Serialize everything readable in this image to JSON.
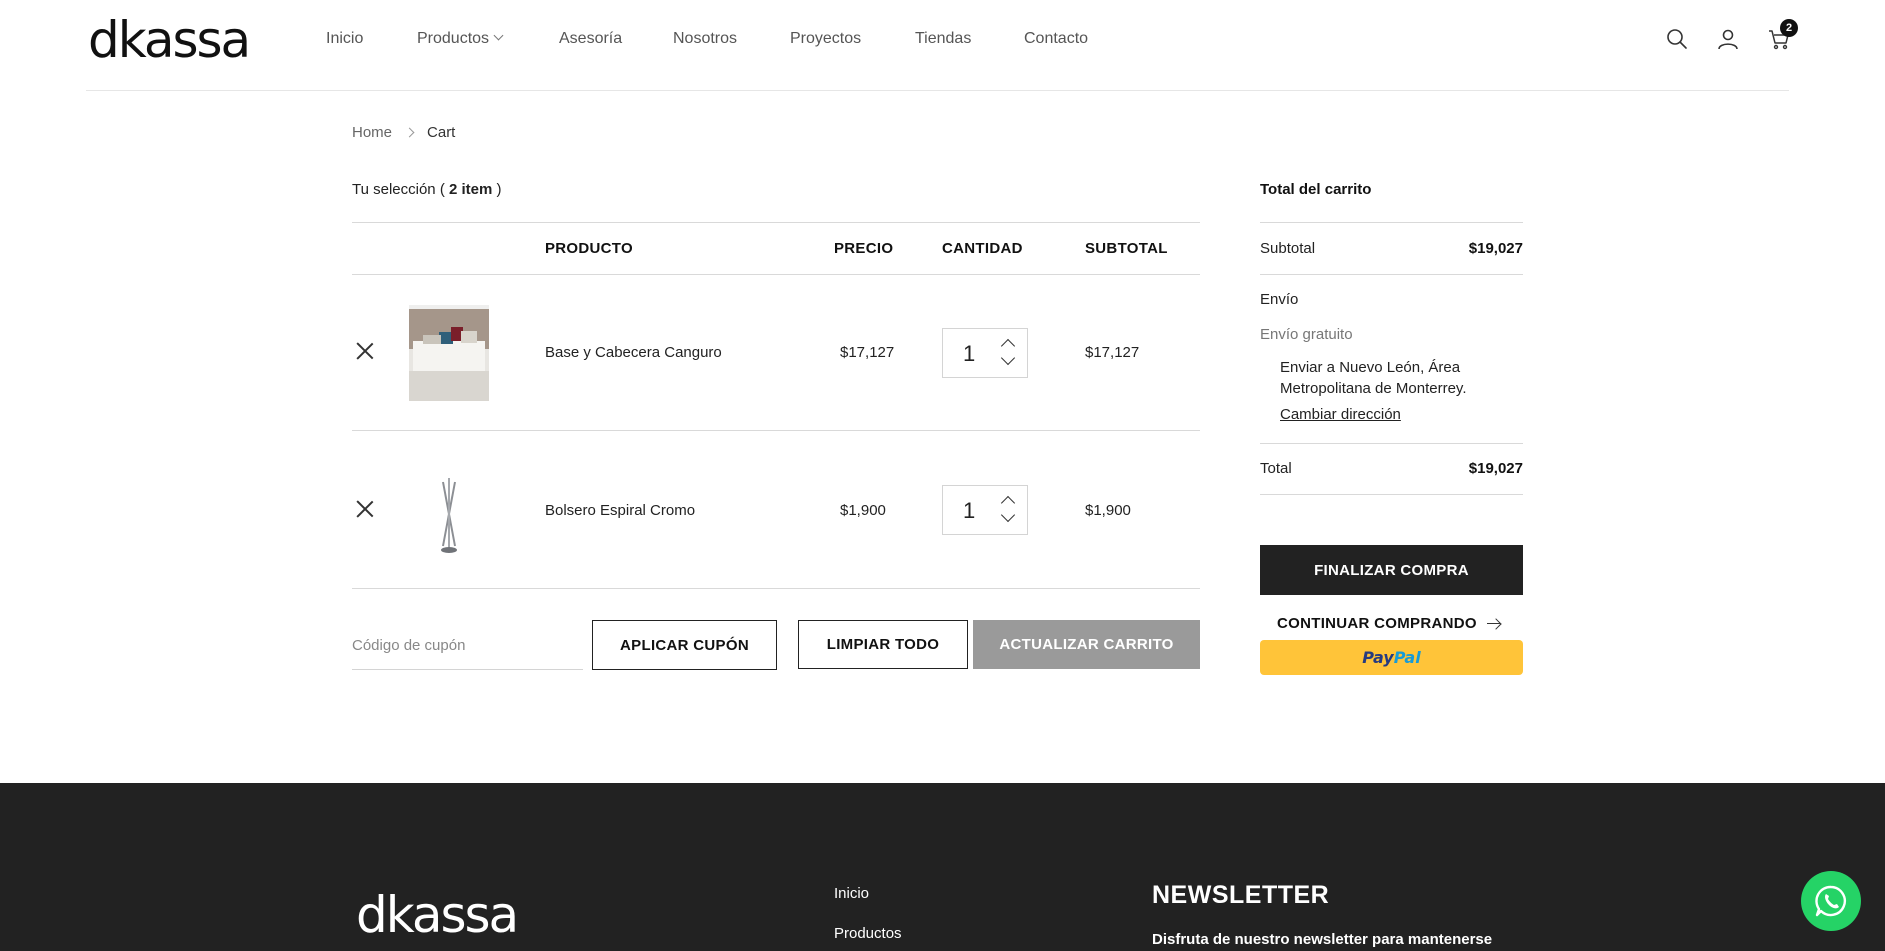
{
  "brand": {
    "logo": "dkassa"
  },
  "nav": {
    "items": [
      {
        "label": "Inicio"
      },
      {
        "label": "Productos"
      },
      {
        "label": "Asesoría"
      },
      {
        "label": "Nosotros"
      },
      {
        "label": "Proyectos"
      },
      {
        "label": "Tiendas"
      },
      {
        "label": "Contacto"
      }
    ],
    "cart_count": "2",
    "icons": [
      "search-icon",
      "user-icon",
      "cart-icon"
    ]
  },
  "breadcrumb": {
    "home": "Home",
    "current": "Cart"
  },
  "selection": {
    "prefix": "Tu selección (",
    "count": "2 item",
    "suffix": ")"
  },
  "table": {
    "headers": {
      "product": "PRODUCTO",
      "price": "PRECIO",
      "qty": "CANTIDAD",
      "subtotal": "SUBTOTAL"
    },
    "rows": [
      {
        "name": "Base y Cabecera Canguro",
        "price": "$17,127",
        "qty": "1",
        "subtotal": "$17,127"
      },
      {
        "name": "Bolsero Espiral Cromo",
        "price": "$1,900",
        "qty": "1",
        "subtotal": "$1,900"
      }
    ]
  },
  "coupon": {
    "placeholder": "Código de cupón",
    "apply_label": "APLICAR CUPÓN",
    "clear_label": "LIMPIAR TODO",
    "update_label": "ACTUALIZAR CARRITO"
  },
  "totals": {
    "title": "Total del carrito",
    "subtotal_label": "Subtotal",
    "subtotal_value": "$19,027",
    "shipping_label": "Envío",
    "shipping_method": "Envío gratuito",
    "shipping_address": "Enviar a Nuevo León, Área Metropolitana de Monterrey.",
    "change_address": "Cambiar dirección",
    "total_label": "Total",
    "total_value": "$19,027",
    "checkout_label": "FINALIZAR COMPRA",
    "continue_label": "CONTINUAR COMPRANDO",
    "paypal_a": "Pay",
    "paypal_b": "Pal"
  },
  "footer": {
    "logo": "dkassa",
    "links": [
      "Inicio",
      "Productos"
    ],
    "newsletter_title": "NEWSLETTER",
    "newsletter_text": "Disfruta de nuestro newsletter para mantenerse"
  },
  "colors": {
    "footer_bg": "#222222",
    "paypal": "#ffc439",
    "whatsapp": "#25d366",
    "checkout_bg": "#222222"
  }
}
